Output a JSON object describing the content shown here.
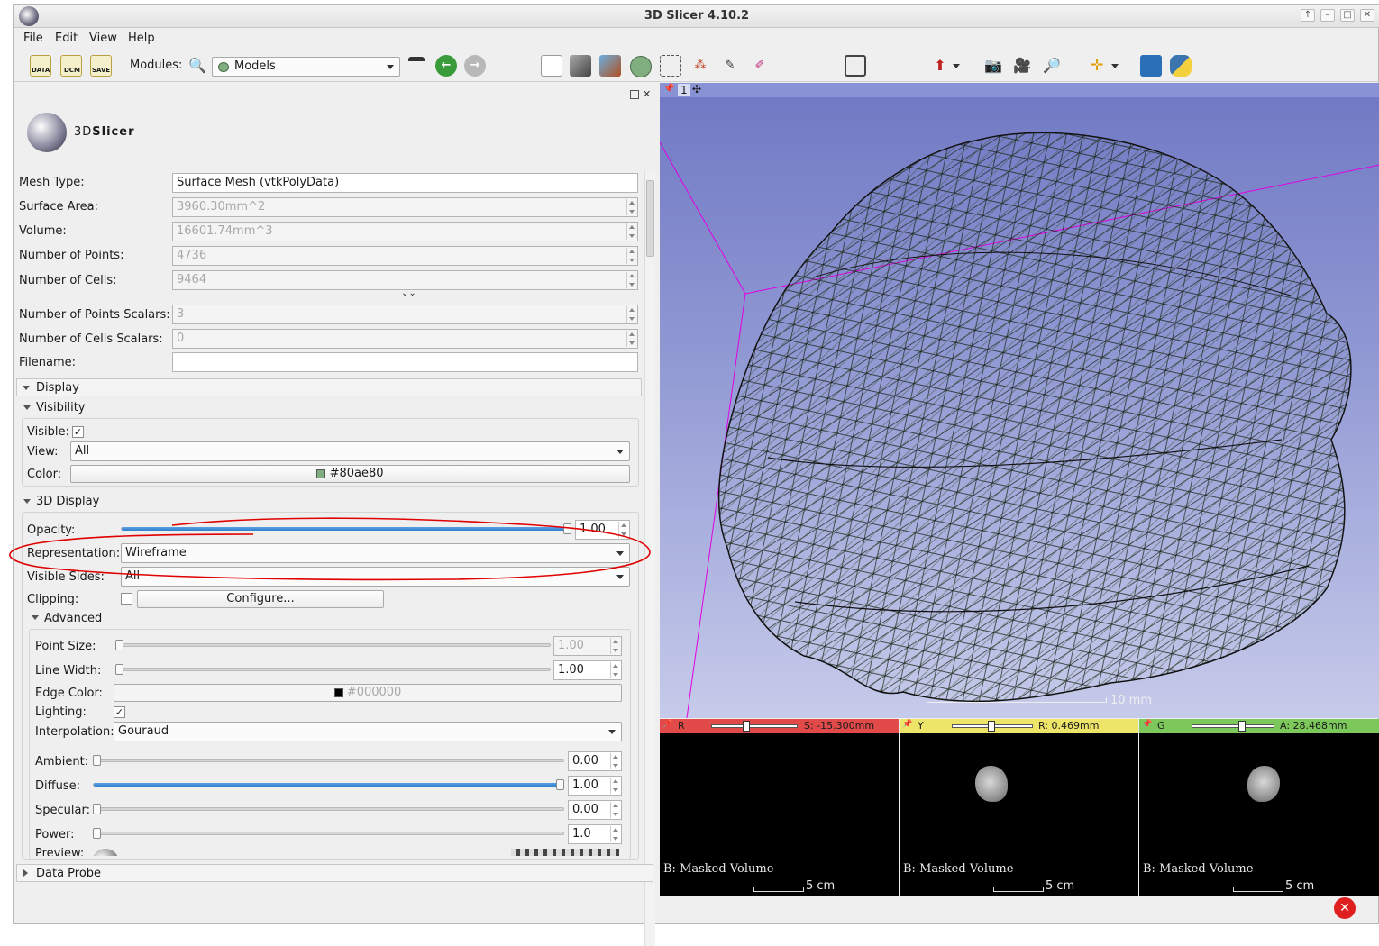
{
  "window": {
    "title": "3D Slicer 4.10.2"
  },
  "menu": [
    "File",
    "Edit",
    "View",
    "Help"
  ],
  "toolbar": {
    "data_label": "DATA",
    "dcm_label": "DCM",
    "save_label": "SAVE",
    "modules_label": "Modules:",
    "module_selected": "Models"
  },
  "logo": {
    "text_prefix": "3D",
    "text_main": "Slicer"
  },
  "info": {
    "mesh_type_label": "Mesh Type:",
    "mesh_type": "Surface Mesh (vtkPolyData)",
    "surface_area_label": "Surface Area:",
    "surface_area": "3960.30mm^2",
    "volume_label": "Volume:",
    "volume": "16601.74mm^3",
    "points_label": "Number of Points:",
    "points": "4736",
    "cells_label": "Number of Cells:",
    "cells": "9464",
    "points_scalars_label": "Number of Points Scalars:",
    "points_scalars": "3",
    "cells_scalars_label": "Number of Cells Scalars:",
    "cells_scalars": "0",
    "filename_label": "Filename:",
    "filename": ""
  },
  "display": {
    "section_label": "Display",
    "visibility_label": "Visibility",
    "visible_label": "Visible:",
    "view_label": "View:",
    "view_value": "All",
    "color_label": "Color:",
    "color_value": "#80ae80",
    "display3d_label": "3D Display",
    "opacity_label": "Opacity:",
    "opacity_value": "1.00",
    "representation_label": "Representation:",
    "representation_value": "Wireframe",
    "visible_sides_label": "Visible Sides:",
    "visible_sides_value": "All",
    "clipping_label": "Clipping:",
    "configure_label": "Configure...",
    "advanced_label": "Advanced",
    "point_size_label": "Point Size:",
    "point_size_value": "1.00",
    "line_width_label": "Line Width:",
    "line_width_value": "1.00",
    "edge_color_label": "Edge Color:",
    "edge_color_value": "#000000",
    "lighting_label": "Lighting:",
    "interpolation_label": "Interpolation:",
    "interpolation_value": "Gouraud",
    "ambient_label": "Ambient:",
    "ambient_value": "0.00",
    "diffuse_label": "Diffuse:",
    "diffuse_value": "1.00",
    "specular_label": "Specular:",
    "specular_value": "0.00",
    "power_label": "Power:",
    "power_value": "1.0",
    "preview_label": "Preview:"
  },
  "data_probe_label": "Data Probe",
  "view3d": {
    "number": "1",
    "scale_text": "10 mm"
  },
  "slices": [
    {
      "letter": "R",
      "offset": "S: -15.300mm",
      "color": "#e24a4a",
      "label": "B: Masked Volume",
      "scale": "5 cm"
    },
    {
      "letter": "Y",
      "offset": "R: 0.469mm",
      "color": "#ede46a",
      "label": "B: Masked Volume",
      "scale": "5 cm"
    },
    {
      "letter": "G",
      "offset": "A: 28.468mm",
      "color": "#7cc85a",
      "label": "B: Masked Volume",
      "scale": "5 cm"
    }
  ],
  "colors": {
    "model": "#80ae80",
    "background_top": "#7078c4",
    "annotation": "#e00000"
  }
}
